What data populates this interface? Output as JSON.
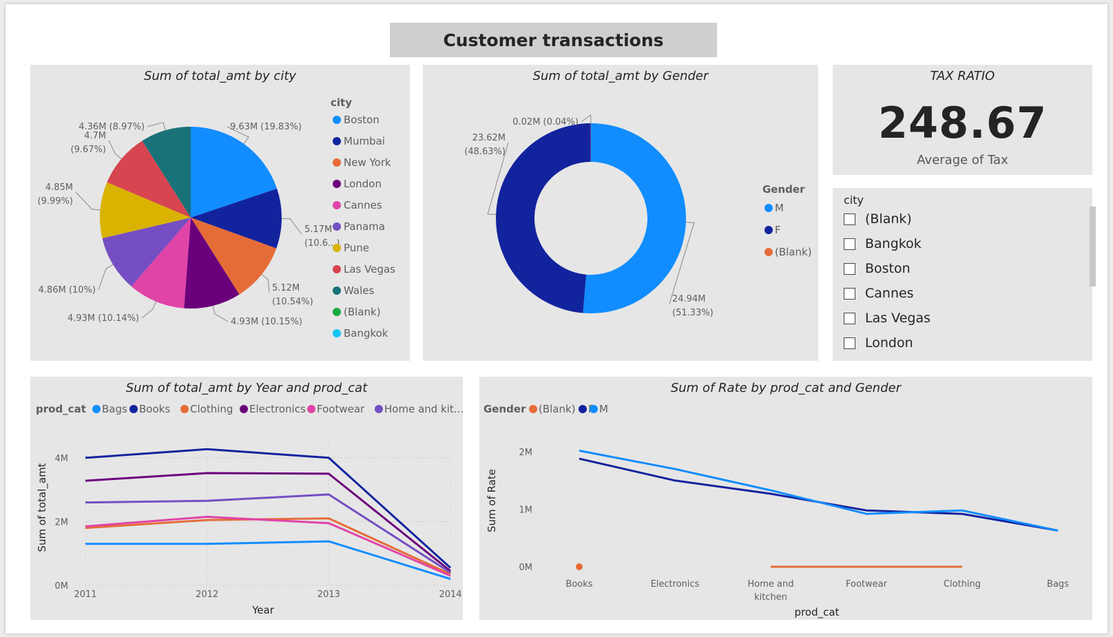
{
  "report_title": "Customer transactions",
  "colors": {
    "Boston": "#118dff",
    "Mumbai": "#12239e",
    "New York": "#e66c37",
    "London": "#6b007b",
    "Cannes": "#e044a7",
    "Panama": "#744ec2",
    "Pune": "#d9b300",
    "Las Vegas": "#d64550",
    "Wales": "#197278",
    "Blank_green": "#1aab40",
    "Bangkok": "#15c6f4"
  },
  "pie": {
    "title": "Sum of total_amt by city",
    "legend_title": "city",
    "slices": [
      {
        "city": "Boston",
        "value": 9.63,
        "label": "9.63M (19.83%)",
        "color": "#118dff"
      },
      {
        "city": "Mumbai",
        "value": 5.17,
        "label": "5.17M (10.6...)",
        "color": "#12239e"
      },
      {
        "city": "New York",
        "value": 5.12,
        "label": "5.12M (10.54%)",
        "color": "#e66c37"
      },
      {
        "city": "London",
        "value": 4.93,
        "label": "4.93M (10.15%)",
        "color": "#6b007b"
      },
      {
        "city": "Cannes",
        "value": 4.93,
        "label": "4.93M (10.14%)",
        "color": "#e044a7"
      },
      {
        "city": "Panama",
        "value": 4.86,
        "label": "4.86M (10%)",
        "color": "#744ec2"
      },
      {
        "city": "Pune",
        "value": 4.85,
        "label": "4.85M (9.99%)",
        "color": "#d9b300"
      },
      {
        "city": "Las Vegas",
        "value": 4.7,
        "label": "4.7M (9.67%)",
        "color": "#d64550"
      },
      {
        "city": "Wales",
        "value": 4.36,
        "label": "4.36M (8.97%)",
        "color": "#197278"
      }
    ],
    "legend": [
      {
        "label": "Boston",
        "color": "#118dff"
      },
      {
        "label": "Mumbai",
        "color": "#12239e"
      },
      {
        "label": "New York",
        "color": "#e66c37"
      },
      {
        "label": "London",
        "color": "#6b007b"
      },
      {
        "label": "Cannes",
        "color": "#e044a7"
      },
      {
        "label": "Panama",
        "color": "#744ec2"
      },
      {
        "label": "Pune",
        "color": "#d9b300"
      },
      {
        "label": "Las Vegas",
        "color": "#d64550"
      },
      {
        "label": "Wales",
        "color": "#197278"
      },
      {
        "label": "(Blank)",
        "color": "#1aab40"
      },
      {
        "label": "Bangkok",
        "color": "#15c6f4"
      }
    ]
  },
  "donut": {
    "title": "Sum of total_amt by Gender",
    "legend_title": "Gender",
    "slices": [
      {
        "gender": "M",
        "value": 24.94,
        "label": "24.94M (51.33%)",
        "color": "#118dff"
      },
      {
        "gender": "F",
        "value": 23.62,
        "label": "23.62M (48.63%)",
        "color": "#12239e"
      },
      {
        "gender": "(Blank)",
        "value": 0.02,
        "label": "0.02M (0.04%)",
        "color": "#e66c37"
      }
    ],
    "legend": [
      {
        "label": "M",
        "color": "#118dff"
      },
      {
        "label": "F",
        "color": "#12239e"
      },
      {
        "label": "(Blank)",
        "color": "#e66c37"
      }
    ]
  },
  "kpi": {
    "title": "TAX RATIO",
    "value": "248.67",
    "label": "Average of Tax"
  },
  "slicer": {
    "title": "city",
    "items": [
      "(Blank)",
      "Bangkok",
      "Boston",
      "Cannes",
      "Las Vegas",
      "London"
    ]
  },
  "line_chart": {
    "title": "Sum of total_amt by Year and prod_cat",
    "legend_title": "prod_cat",
    "legend": [
      {
        "label": "Bags",
        "color": "#118dff"
      },
      {
        "label": "Books",
        "color": "#12239e"
      },
      {
        "label": "Clothing",
        "color": "#e66c37"
      },
      {
        "label": "Electronics",
        "color": "#6b007b"
      },
      {
        "label": "Footwear",
        "color": "#e044a7"
      },
      {
        "label": "Home and kit...",
        "color": "#744ec2"
      }
    ],
    "xlabel": "Year",
    "ylabel": "Sum of total_amt",
    "y_ticks": [
      "4M",
      "2M",
      "0M"
    ]
  },
  "rate_chart": {
    "title": "Sum of Rate by prod_cat and Gender",
    "legend_title": "Gender",
    "legend": [
      {
        "label": "(Blank)",
        "color": "#e66c37"
      },
      {
        "label": "F",
        "color": "#12239e"
      },
      {
        "label": "M",
        "color": "#118dff"
      }
    ],
    "xlabel": "prod_cat",
    "ylabel": "Sum of Rate",
    "y_ticks": [
      "2M",
      "1M",
      "0M"
    ]
  },
  "chart_data": [
    {
      "type": "pie",
      "title": "Sum of total_amt by city",
      "categories": [
        "Boston",
        "Mumbai",
        "New York",
        "London",
        "Cannes",
        "Panama",
        "Pune",
        "Las Vegas",
        "Wales"
      ],
      "values": [
        9.63,
        5.17,
        5.12,
        4.93,
        4.93,
        4.86,
        4.85,
        4.7,
        4.36
      ],
      "unit": "M"
    },
    {
      "type": "pie",
      "title": "Sum of total_amt by Gender",
      "categories": [
        "M",
        "F",
        "(Blank)"
      ],
      "values": [
        24.94,
        23.62,
        0.02
      ],
      "unit": "M"
    },
    {
      "type": "line",
      "title": "Sum of total_amt by Year and prod_cat",
      "x": [
        2011,
        2012,
        2013,
        2014
      ],
      "series": [
        {
          "name": "Bags",
          "values": [
            1.3,
            1.3,
            1.38,
            0.2
          ]
        },
        {
          "name": "Books",
          "values": [
            4.0,
            4.27,
            4.0,
            0.55
          ]
        },
        {
          "name": "Clothing",
          "values": [
            1.8,
            2.05,
            2.1,
            0.35
          ]
        },
        {
          "name": "Electronics",
          "values": [
            3.28,
            3.52,
            3.5,
            0.45
          ]
        },
        {
          "name": "Footwear",
          "values": [
            1.85,
            2.15,
            1.95,
            0.3
          ]
        },
        {
          "name": "Home and kit...",
          "values": [
            2.6,
            2.65,
            2.85,
            0.4
          ]
        }
      ],
      "xlabel": "Year",
      "ylabel": "Sum of total_amt",
      "ylim": [
        0,
        4.6
      ],
      "unit": "M"
    },
    {
      "type": "line",
      "title": "Sum of Rate by prod_cat and Gender",
      "categories": [
        "Books",
        "Electronics",
        "Home and kitchen",
        "Footwear",
        "Clothing",
        "Bags"
      ],
      "series": [
        {
          "name": "F",
          "values": [
            1.88,
            1.5,
            1.27,
            0.98,
            0.92,
            0.63
          ]
        },
        {
          "name": "M",
          "values": [
            2.02,
            1.7,
            1.33,
            0.92,
            0.98,
            0.63
          ]
        },
        {
          "name": "(Blank)",
          "values": [
            0,
            null,
            0,
            0,
            0,
            null
          ]
        }
      ],
      "xlabel": "prod_cat",
      "ylabel": "Sum of Rate",
      "ylim": [
        0,
        2.3
      ],
      "unit": "M"
    }
  ]
}
